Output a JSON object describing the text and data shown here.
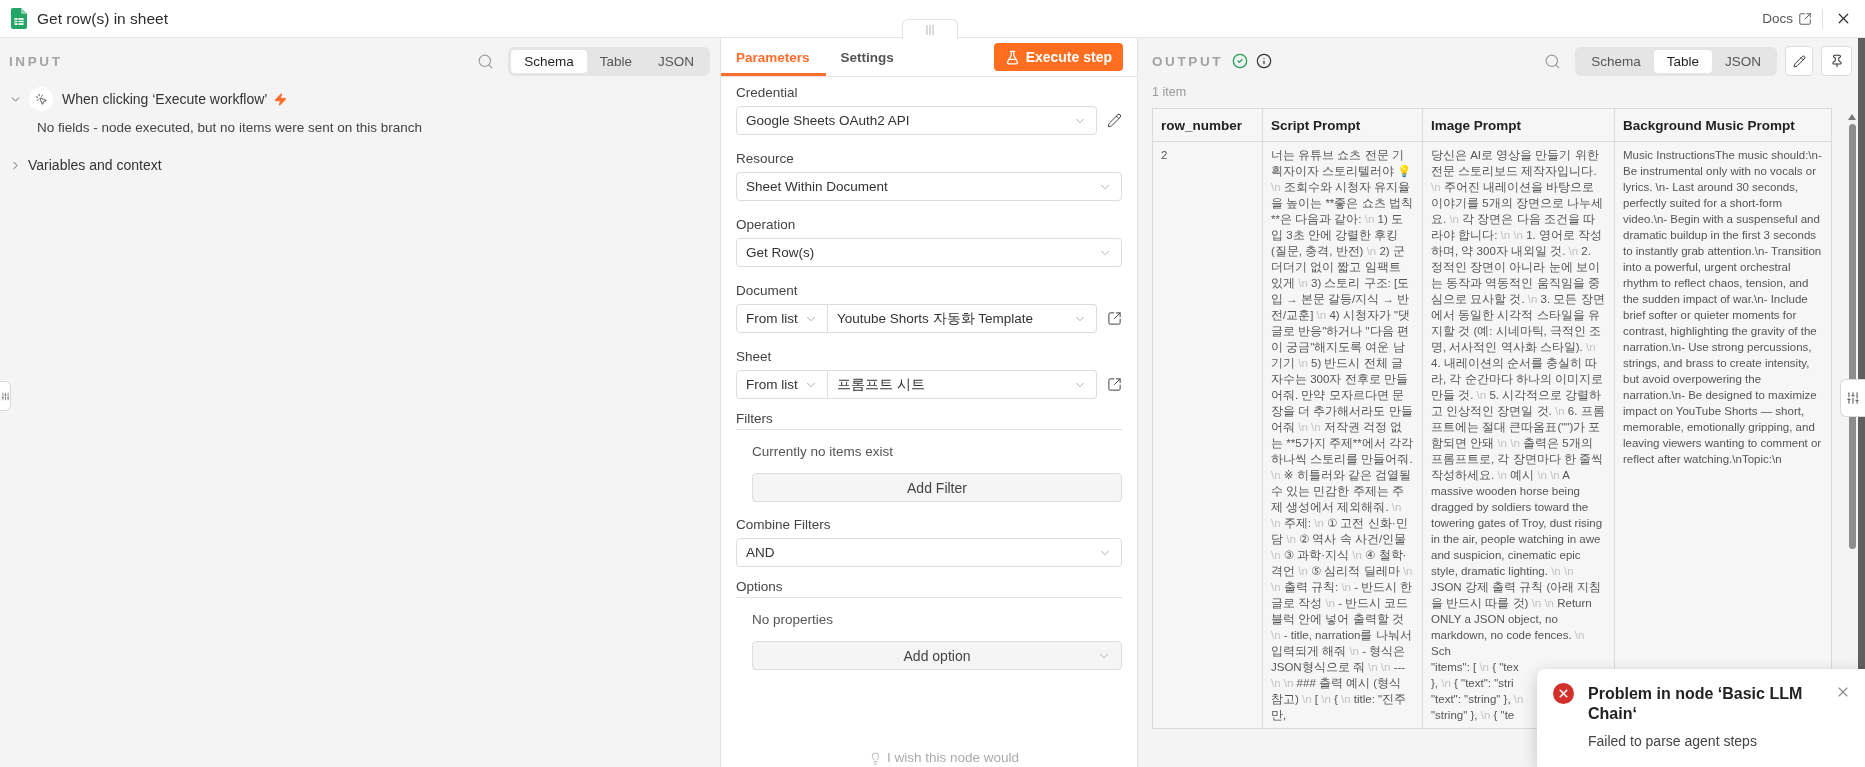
{
  "header": {
    "title": "Get row(s) in sheet",
    "docs_link": "Docs"
  },
  "input": {
    "heading": "INPUT",
    "view_tabs": [
      {
        "label": "Schema",
        "selected": true
      },
      {
        "label": "Table",
        "selected": false
      },
      {
        "label": "JSON",
        "selected": false
      }
    ],
    "tree": [
      {
        "kind": "trigger",
        "label": "When clicking ‘Execute workflow’",
        "expanded": true,
        "message": "No fields - node executed, but no items were sent on this branch"
      },
      {
        "kind": "section",
        "label": "Variables and context",
        "expanded": false
      }
    ]
  },
  "parameters": {
    "tabs": [
      {
        "label": "Parameters",
        "selected": true
      },
      {
        "label": "Settings",
        "selected": false
      }
    ],
    "execute_button": "Execute step",
    "fields": [
      {
        "kind": "select",
        "label": "Credential",
        "value": "Google Sheets OAuth2 API",
        "editable": true
      },
      {
        "kind": "select",
        "label": "Resource",
        "value": "Sheet Within Document"
      },
      {
        "kind": "select",
        "label": "Operation",
        "value": "Get Row(s)"
      },
      {
        "kind": "resource",
        "label": "Document",
        "mode": "From list",
        "value": "Youtube Shorts 자동화 Template",
        "external_link": true
      },
      {
        "kind": "resource",
        "label": "Sheet",
        "mode": "From list",
        "value": "프롬프트 시트",
        "external_link": true
      },
      {
        "kind": "collection",
        "label": "Filters",
        "empty_text": "Currently no items exist",
        "button": "Add Filter",
        "dropdown": false
      },
      {
        "kind": "select",
        "label": "Combine Filters",
        "value": "AND"
      },
      {
        "kind": "collection",
        "label": "Options",
        "empty_text": "No properties",
        "button": "Add option",
        "dropdown": true
      }
    ],
    "hint": "I wish this node would"
  },
  "output": {
    "heading": "OUTPUT",
    "success": true,
    "view_tabs": [
      {
        "label": "Schema",
        "selected": false
      },
      {
        "label": "Table",
        "selected": true
      },
      {
        "label": "JSON",
        "selected": false
      }
    ],
    "item_count": "1 item",
    "table": {
      "columns": [
        "row_number",
        "Script Prompt",
        "Image Prompt",
        "Background Music Prompt"
      ],
      "rows": [
        [
          {
            "kind": "plain",
            "text": "2"
          },
          {
            "kind": "multiline",
            "text": "너는 유튜브 쇼츠 전문 기획자이자 스토리텔러야 💡 \\n 조회수와 시청자 유지율을 높이는 **좋은 쇼츠 법칙**은 다음과 같아: \\n 1) 도입 3초 안에 강렬한 후킹 (질문, 충격, 반전) \\n 2) 군더더기 없이 짧고 임팩트 있게 \\n 3) 스토리 구조: [도입 → 본문 갈등/지식 → 반전/교훈] \\n 4) 시청자가 \"댓글로 반응\"하거나 \"다음 편이 궁금\"해지도록 여운 남기기 \\n 5) 반드시 전체 글자수는 300자 전후로 만들어줘. 만약 모자르다면 문장을 더 추가해서라도 만들어줘 \\n \\n 저작권 걱정 없는 **5가지 주제**에서 각각 하나씩 스토리를 만들어줘. \\n ※ 히틀러와 같은 검열될 수 있는 민감한 주제는 주제 생성에서 제외해줘. \\n \\n 주제: \\n ① 고전 신화·민담 \\n ② 역사 속 사건/인물 \\n ③ 과학·지식 \\n ④ 철학·격언 \\n ⑤ 심리적 딜레마 \\n \\n 출력 규칙: \\n - 반드시 한글로 작성 \\n - 반드시 코드블럭 안에 넣어 출력할 것 \\n - title, narration를 나눠서 입력되게 해줘 \\n - 형식은 JSON형식으로 줘 \\n \\n --- \\n \\n ### 출력 예시 (형식 참고) \\n [ \\n { \\n title: \"진주만,"
          },
          {
            "kind": "multiline",
            "text": "당신은 AI로 영상을 만들기 위한 전문 스토리보드 제작자입니다. \\n 주어진 내레이션을 바탕으로 이야기를 5개의 장면으로 나누세요. \\n 각 장면은 다음 조건을 따라야 합니다: \\n \\n 1. 영어로 작성하며, 약 300자 내외일 것. \\n 2. 정적인 장면이 아니라 눈에 보이는 동작과 역동적인 움직임을 중심으로 묘사할 것. \\n 3. 모든 장면에서 동일한 시각적 스타일을 유지할 것 (예: 시네마틱, 극적인 조명, 서사적인 역사화 스타일). \\n 4. 내레이션의 순서를 충실히 따라, 각 순간마다 하나의 이미지로 만들 것. \\n 5. 시각적으로 강렬하고 인상적인 장면일 것. \\n 6. 프롬프트에는 절대 큰따옴표(\"\")가 포함되면 안돼 \\n \\n 출력은 5개의 프롬프트로, 각 장면마다 한 줄씩 작성하세요. \\n 예시 \\n \\n A massive wooden horse being dragged by soldiers toward the towering gates of Troy, dust rising in the air, people watching in awe and suspicion, cinematic epic style, dramatic lighting. \\n \\n JSON 강제 출력 규칙 (아래 지침을 반드시 따를 것) \\n \\n Return ONLY a JSON object, no markdown, no code fences. \\n Sch",
            "covered_lines": [
              "\"items\": [ \\n { \"tex",
              "}, \\n { \"text\": \"stri",
              "\"text\": \"string\" }, \\n",
              "\"string\" }, \\n { \"te"
            ]
          },
          {
            "kind": "plain",
            "text": "Music InstructionsThe music should:\\n- Be instrumental only with no vocals or lyrics. \\n- Last around 30 seconds, perfectly suited for a short-form video.\\n- Begin with a suspenseful and dramatic buildup in the first 3 seconds to instantly grab attention.\\n- Transition into a powerful, urgent orchestral rhythm to reflect chaos, tension, and the sudden impact of war.\\n- Include brief softer or quieter moments for contrast, highlighting the gravity of the narration.\\n- Use strong percussions, strings, and brass to create intensity, but avoid overpowering the narration.\\n- Be designed to maximize impact on YouTube Shorts — short, memorable, emotionally gripping, and leaving viewers wanting to comment or reflect after watching.\\nTopic:\\n"
          }
        ]
      ]
    }
  },
  "toast": {
    "kind": "error",
    "title": "Problem in node ‘Basic LLM Chain‘",
    "message": "Failed to parse agent steps"
  }
}
